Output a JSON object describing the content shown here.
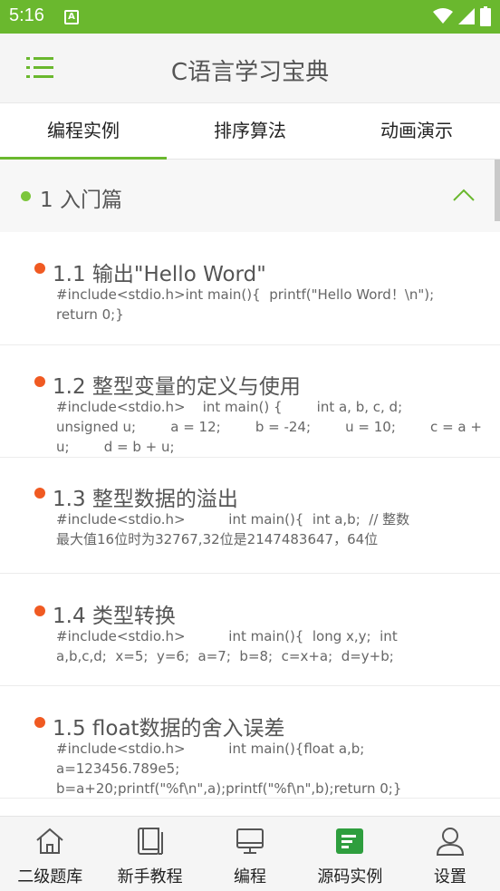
{
  "status_bar": {
    "time": "5:16",
    "notification_letter": "A"
  },
  "app_bar": {
    "title": "C语言学习宝典"
  },
  "tabs": [
    {
      "label": "编程实例",
      "active": true
    },
    {
      "label": "排序算法",
      "active": false
    },
    {
      "label": "动画演示",
      "active": false
    }
  ],
  "section": {
    "title": "1 入门篇"
  },
  "items": [
    {
      "title": "1.1 输出\"Hello Word\"",
      "code": "#include<stdio.h>int main(){  printf(\"Hello Word！\\n\");  return 0;}"
    },
    {
      "title": "1.2 整型变量的定义与使用",
      "code": "#include<stdio.h>    int main() {        int a, b, c, d;        unsigned u;        a = 12;        b = -24;        u = 10;        c = a + u;        d = b + u;"
    },
    {
      "title": "1.3 整型数据的溢出",
      "code": "#include<stdio.h>          int main(){  int a,b;  // 整数最大值16位时为32767,32位是2147483647，64位"
    },
    {
      "title": "1.4 类型转换",
      "code": "#include<stdio.h>          int main(){  long x,y;  int a,b,c,d;  x=5;  y=6;  a=7;  b=8;  c=x+a;  d=y+b;"
    },
    {
      "title": "1.5 float数据的舍入误差",
      "code": "#include<stdio.h>          int main(){float a,b; a=123456.789e5; b=a+20;printf(\"%f\\n\",a);printf(\"%f\\n\",b);return 0;}"
    }
  ],
  "bottom_nav": [
    {
      "label": "二级题库",
      "icon": "house-icon",
      "active": false
    },
    {
      "label": "新手教程",
      "icon": "book-icon",
      "active": false
    },
    {
      "label": "编程",
      "icon": "monitor-icon",
      "active": false
    },
    {
      "label": "源码实例",
      "icon": "code-doc-icon",
      "active": true
    },
    {
      "label": "设置",
      "icon": "user-icon",
      "active": false
    }
  ],
  "colors": {
    "accent": "#6ab82e",
    "item_dot": "#f05a22",
    "section_dot": "#7cc63b"
  }
}
